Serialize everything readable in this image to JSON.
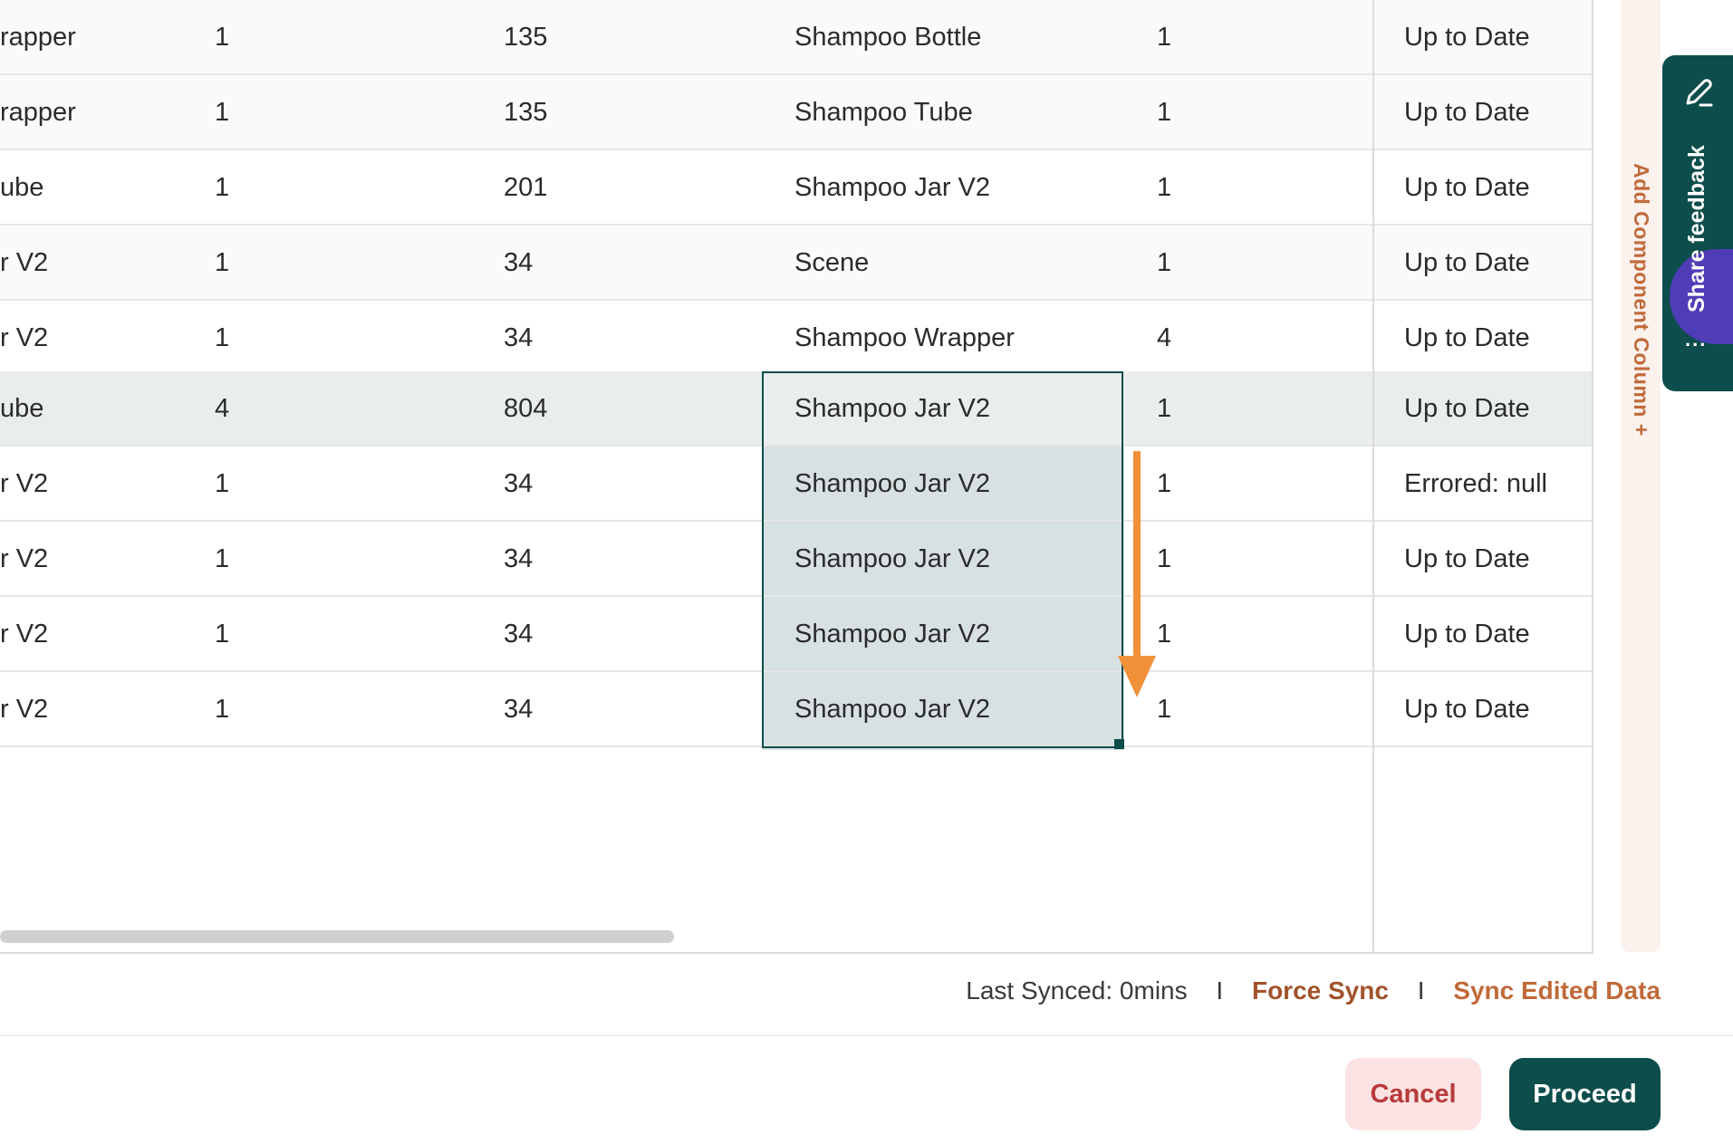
{
  "table": {
    "rows": [
      {
        "c1": "rapper",
        "c2": "1",
        "c3": "135",
        "c4": "Shampoo Bottle",
        "c5": "1",
        "c6": "Up to Date"
      },
      {
        "c1": "rapper",
        "c2": "1",
        "c3": "135",
        "c4": "Shampoo Tube",
        "c5": "1",
        "c6": "Up to Date"
      },
      {
        "c1": "ube",
        "c2": "1",
        "c3": "201",
        "c4": "Shampoo Jar V2",
        "c5": "1",
        "c6": "Up to Date"
      },
      {
        "c1": "r V2",
        "c2": "1",
        "c3": "34",
        "c4": "Scene",
        "c5": "1",
        "c6": "Up to Date"
      },
      {
        "c1": "r V2",
        "c2": "1",
        "c3": "34",
        "c4": "Shampoo Wrapper",
        "c5": "4",
        "c6": "Up to Date"
      },
      {
        "c1": "ube",
        "c2": "4",
        "c3": "804",
        "c4": "Shampoo Jar V2",
        "c5": "1",
        "c6": "Up to Date"
      },
      {
        "c1": "r V2",
        "c2": "1",
        "c3": "34",
        "c4": "Shampoo Jar V2",
        "c5": "1",
        "c6": "Errored: null"
      },
      {
        "c1": "r V2",
        "c2": "1",
        "c3": "34",
        "c4": "Shampoo Jar V2",
        "c5": "1",
        "c6": "Up to Date"
      },
      {
        "c1": "r V2",
        "c2": "1",
        "c3": "34",
        "c4": "Shampoo Jar V2",
        "c5": "1",
        "c6": "Up to Date"
      },
      {
        "c1": "r V2",
        "c2": "1",
        "c3": "34",
        "c4": "Shampoo Jar V2",
        "c5": "1",
        "c6": "Up to Date"
      }
    ]
  },
  "add_column": {
    "label": "Add Component Column +"
  },
  "feedback": {
    "label": "Share feedback",
    "dots": "..."
  },
  "sync": {
    "last_synced": "Last Synced: 0mins",
    "separator": "I",
    "force_sync": "Force Sync",
    "sync_edited": "Sync Edited Data"
  },
  "footer": {
    "cancel_label": "Cancel",
    "proceed_label": "Proceed"
  },
  "colors": {
    "primary": "#0d4d4b",
    "accent": "#c06a3a",
    "drag_arrow": "#f0913a",
    "cancel_bg": "#fbe3e3",
    "cancel_text": "#b83a3a"
  },
  "icons": {
    "feedback": "pencil-icon",
    "drag": "arrow-down-icon"
  }
}
